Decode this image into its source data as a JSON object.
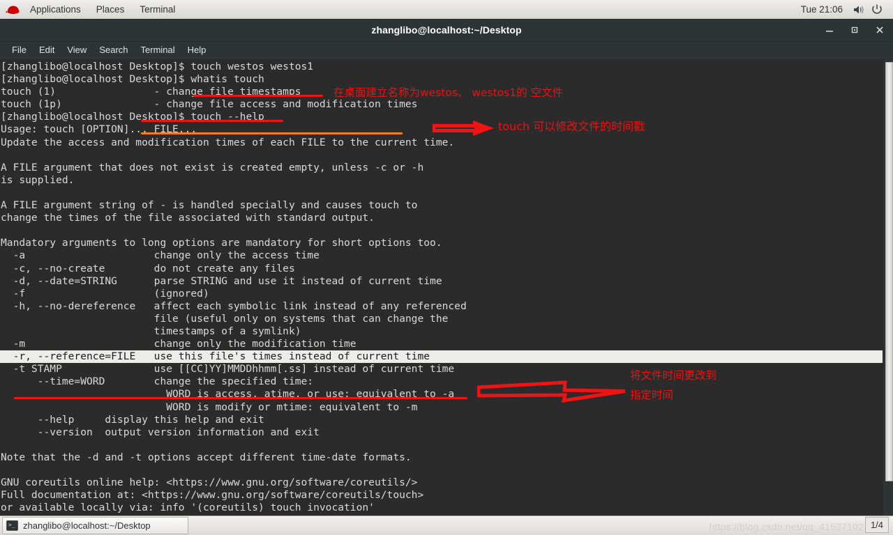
{
  "top_panel": {
    "logo_icon": "redhat-icon",
    "items": [
      "Applications",
      "Places",
      "Terminal"
    ],
    "clock": "Tue 21:06",
    "volume_icon": "volume-icon",
    "power_icon": "power-icon"
  },
  "window": {
    "title": "zhanglibo@localhost:~/Desktop",
    "minimize": "–",
    "maximize": "□",
    "close": "✕",
    "menus": [
      "File",
      "Edit",
      "View",
      "Search",
      "Terminal",
      "Help"
    ]
  },
  "terminal": {
    "lines": [
      "[zhanglibo@localhost Desktop]$ touch westos westos1",
      "[zhanglibo@localhost Desktop]$ whatis touch",
      "touch (1)                - change file timestamps",
      "touch (1p)               - change file access and modification times",
      "[zhanglibo@localhost Desktop]$ touch --help",
      "Usage: touch [OPTION]... FILE...",
      "Update the access and modification times of each FILE to the current time.",
      "",
      "A FILE argument that does not exist is created empty, unless -c or -h",
      "is supplied.",
      "",
      "A FILE argument string of - is handled specially and causes touch to",
      "change the times of the file associated with standard output.",
      "",
      "Mandatory arguments to long options are mandatory for short options too.",
      "  -a                     change only the access time",
      "  -c, --no-create        do not create any files",
      "  -d, --date=STRING      parse STRING and use it instead of current time",
      "  -f                     (ignored)",
      "  -h, --no-dereference   affect each symbolic link instead of any referenced",
      "                         file (useful only on systems that can change the",
      "                         timestamps of a symlink)",
      "  -m                     change only the modification time",
      "  -r, --reference=FILE   use this file's times instead of current time",
      "  -t STAMP               use [[CC]YY]MMDDhhmm[.ss] instead of current time",
      "      --time=WORD        change the specified time:",
      "                           WORD is access, atime, or use: equivalent to -a",
      "                           WORD is modify or mtime: equivalent to -m",
      "      --help     display this help and exit",
      "      --version  output version information and exit",
      "",
      "Note that the -d and -t options accept different time-date formats.",
      "",
      "GNU coreutils online help: <https://www.gnu.org/software/coreutils/>",
      "Full documentation at: <https://www.gnu.org/software/coreutils/touch>",
      "or available locally via: info '(coreutils) touch invocation'"
    ],
    "highlighted_line_index": 23
  },
  "annotations": {
    "note_create_files": "在桌面建立名称为westos、 westos1的 空文件",
    "note_touch_modifies": "touch 可以修改文件的时间戳",
    "note_change_time_l1": "将文件时间更改到",
    "note_change_time_l2": "指定时间",
    "colors": {
      "red": "#f01414",
      "orange": "#f08020"
    }
  },
  "taskbar": {
    "task_icon": "terminal-icon",
    "task_label": "zhanglibo@localhost:~/Desktop",
    "watermark": "https://blog.csdn.net/qq_41537102",
    "workspace": "1/4"
  }
}
